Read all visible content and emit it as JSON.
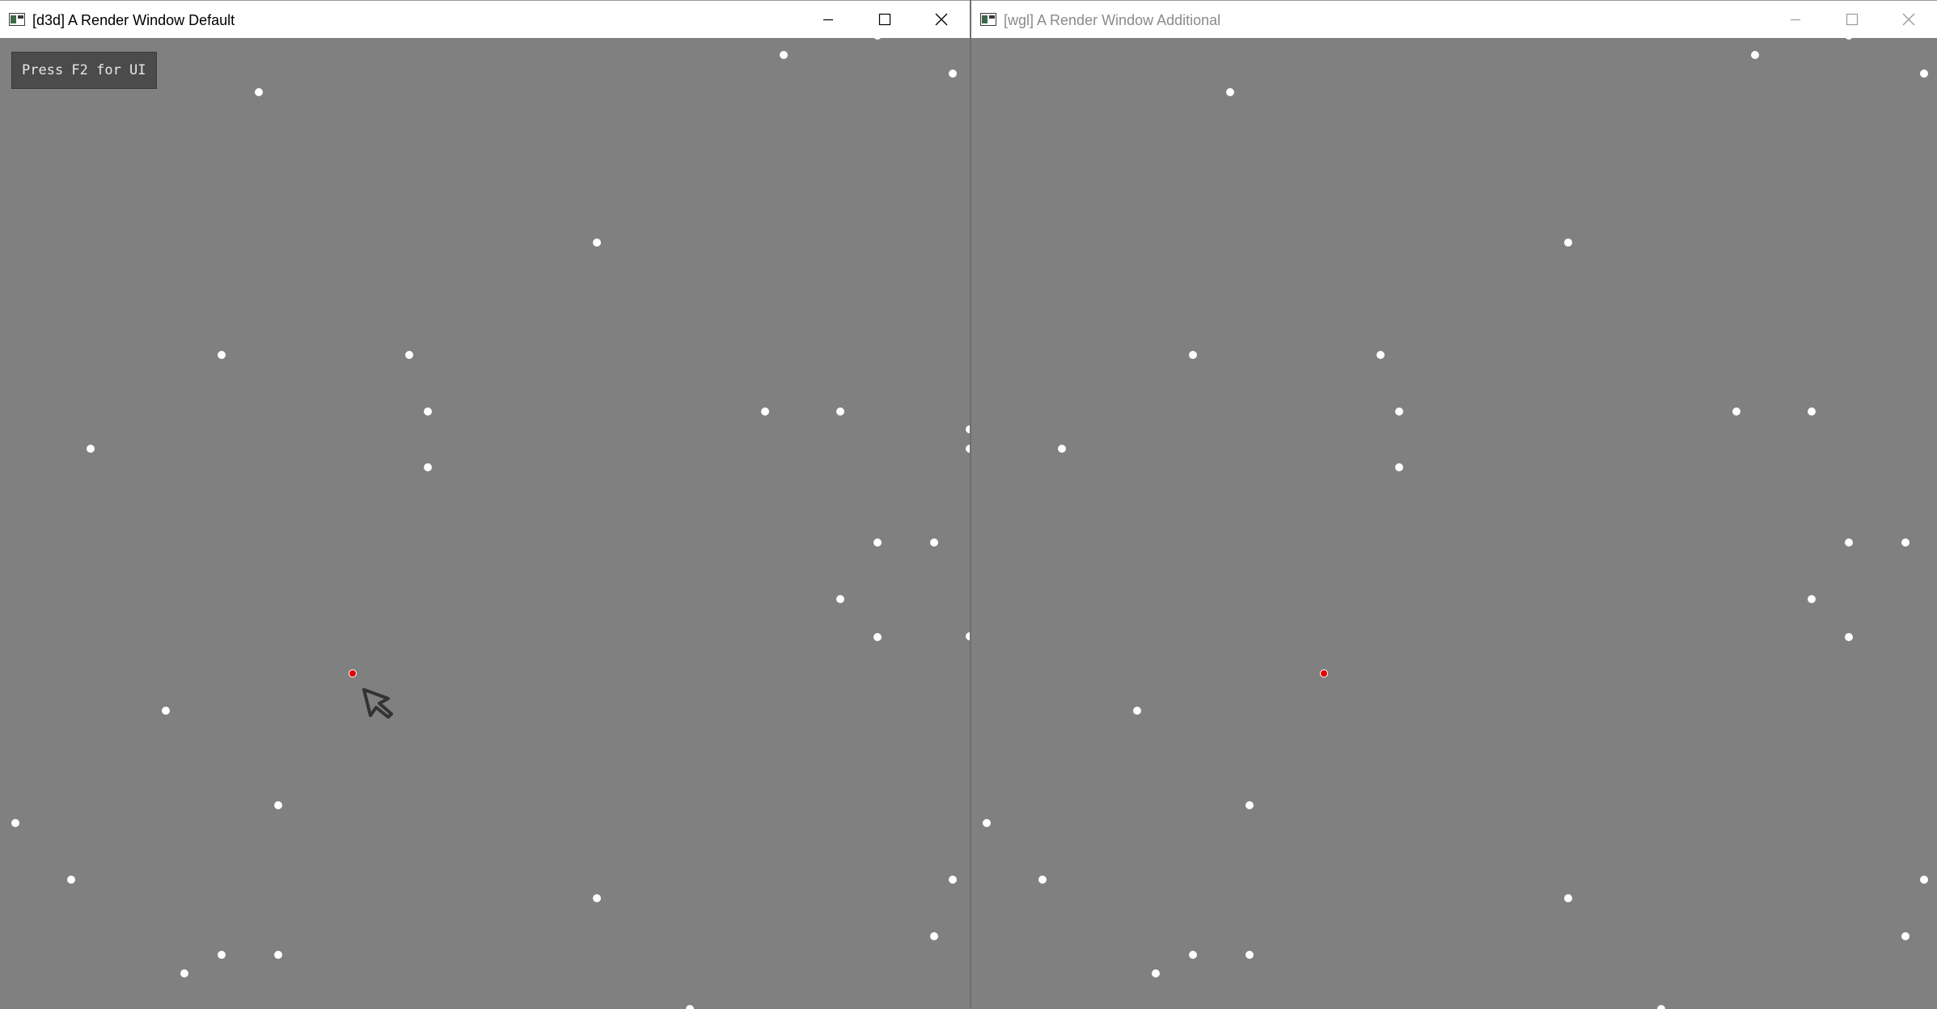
{
  "windows": {
    "default": {
      "title": "[d3d] A Render Window Default",
      "hint": "Press F2 for UI"
    },
    "additional": {
      "title": "[wgl] A Render Window Additional"
    }
  },
  "colors": {
    "background": "#808080",
    "particle": "#ffffff",
    "highlight_particle": "#e00000"
  },
  "icons": [
    "app-icon",
    "minimize-icon",
    "maximize-icon",
    "close-icon",
    "mouse-cursor-icon"
  ]
}
